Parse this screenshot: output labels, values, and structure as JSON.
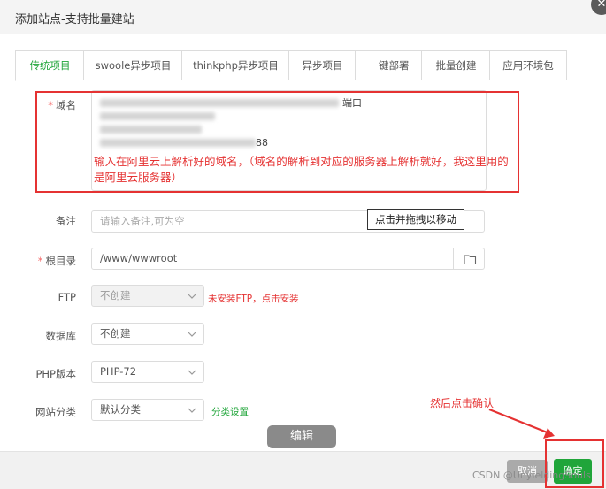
{
  "dialog": {
    "title": "添加站点-支持批量建站"
  },
  "tabs": [
    {
      "label": "传统项目",
      "active": true
    },
    {
      "label": "swoole异步项目"
    },
    {
      "label": "thinkphp异步项目"
    },
    {
      "label": "异步项目"
    },
    {
      "label": "一键部署"
    },
    {
      "label": "批量创建"
    },
    {
      "label": "应用环境包"
    }
  ],
  "form": {
    "domain": {
      "label": "域名",
      "visible_suffix": "端口",
      "visible_number": "88"
    },
    "remark": {
      "label": "备注",
      "placeholder": "请输入备注,可为空"
    },
    "root": {
      "label": "根目录",
      "value": "/www/wwwroot"
    },
    "ftp": {
      "label": "FTP",
      "value": "不创建",
      "warning": "未安装FTP，点击安装"
    },
    "database": {
      "label": "数据库",
      "value": "不创建"
    },
    "php": {
      "label": "PHP版本",
      "value": "PHP-72"
    },
    "category": {
      "label": "网站分类",
      "value": "默认分类",
      "link": "分类设置"
    }
  },
  "annotations": {
    "domain_note": "输入在阿里云上解析好的域名，（域名的解析到对应的服务器上解析就好，我这里用的是阿里云服务器）",
    "drag_tip": "点击并拖拽以移动",
    "edit_label": "编辑",
    "confirm_hint": "然后点击确认"
  },
  "footer": {
    "cancel_label": "取消",
    "confirm_label": "确定"
  },
  "watermark": "CSDN @UnyieldingSouls",
  "colors": {
    "accent": "#20a53a",
    "annotation": "#e53232"
  }
}
